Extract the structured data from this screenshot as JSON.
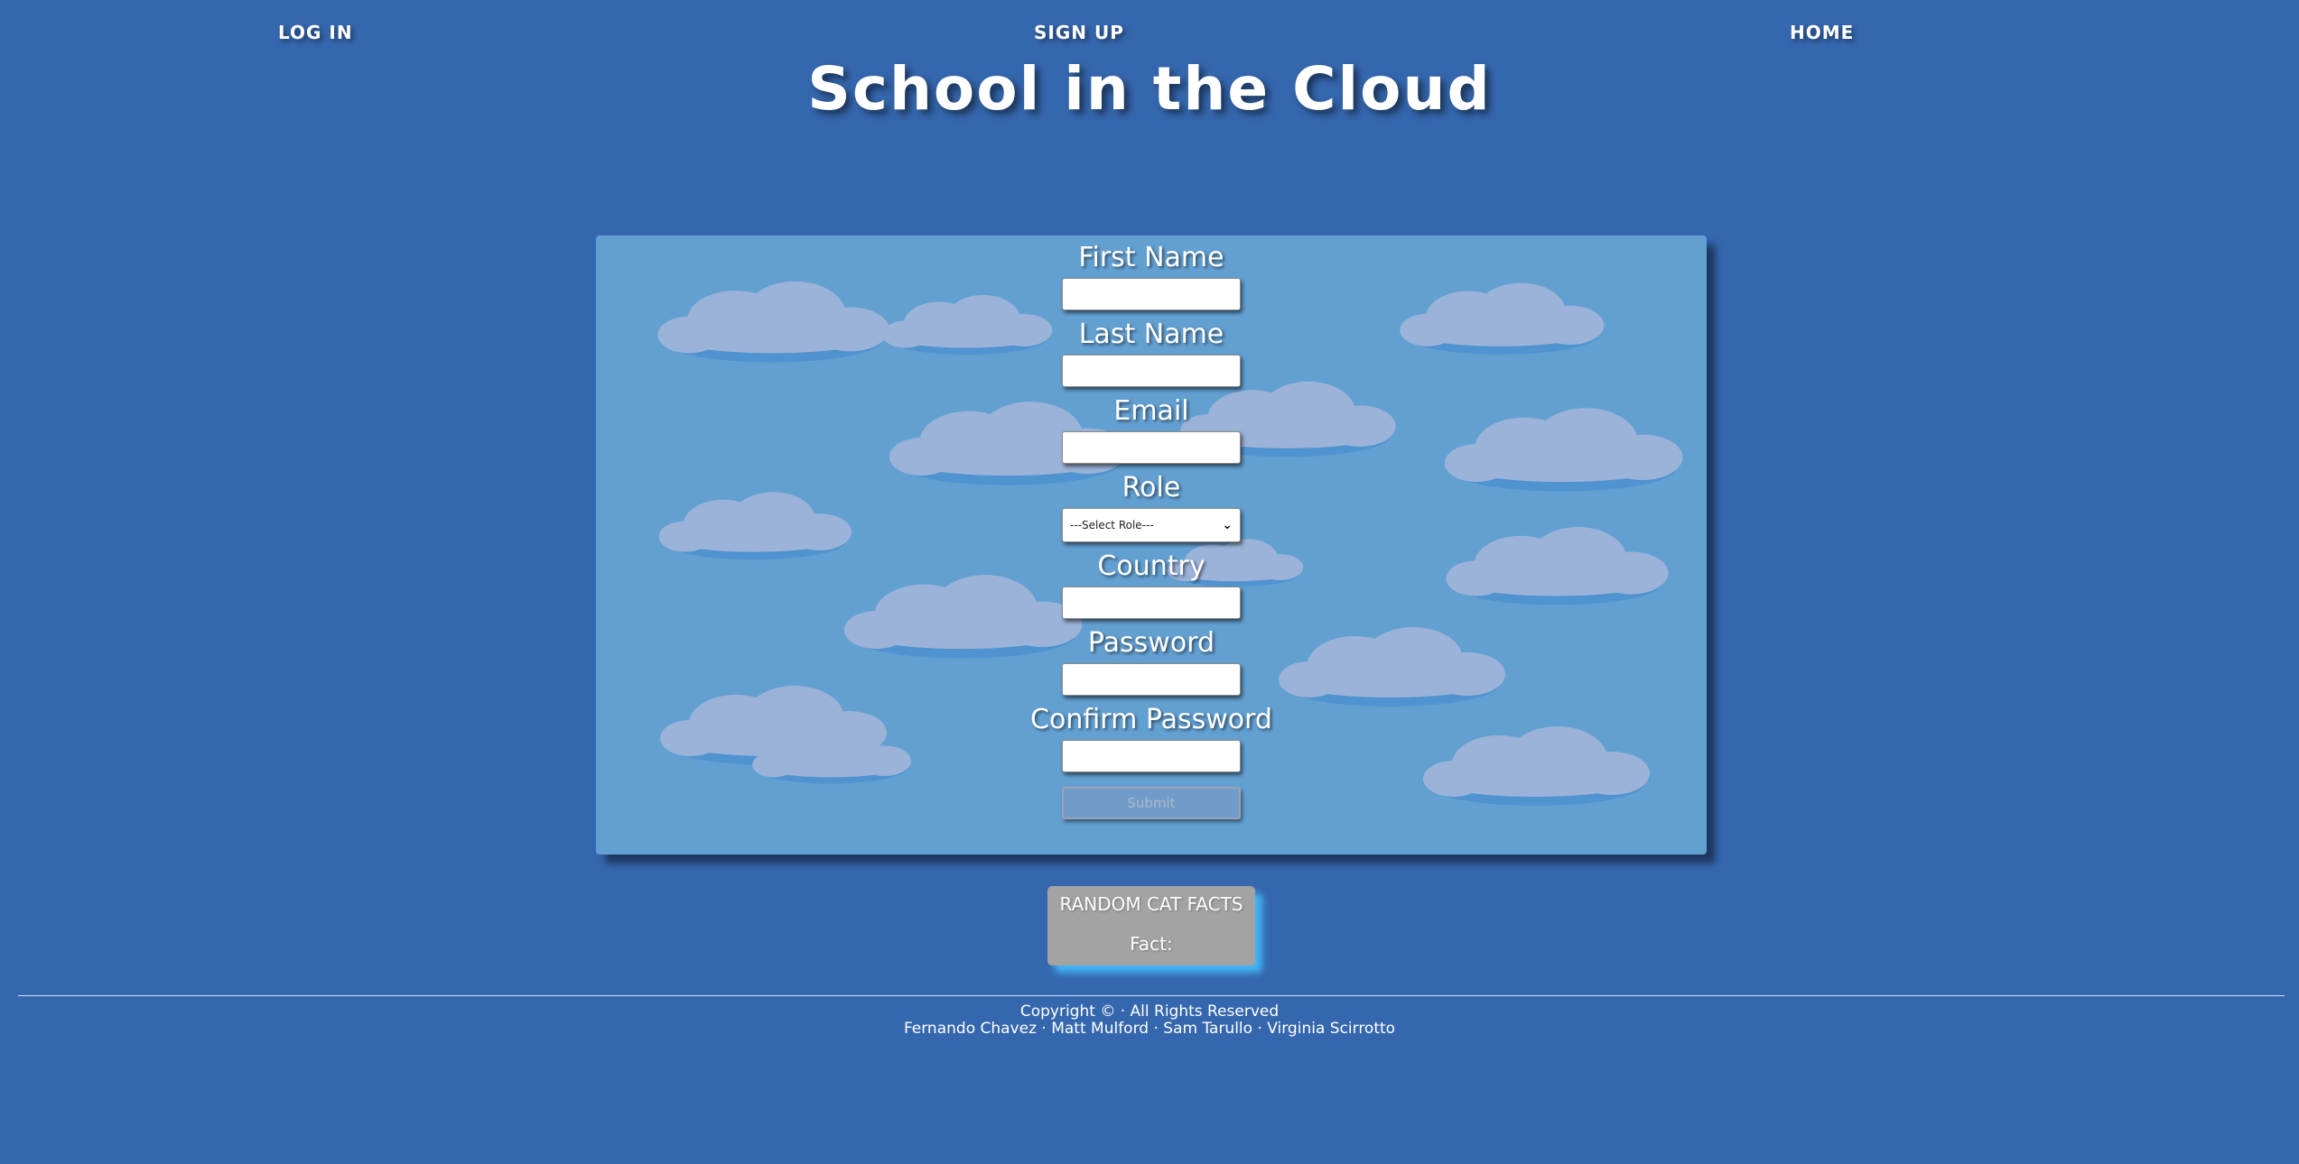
{
  "nav": {
    "login": "LOG IN",
    "signup": "SIGN UP",
    "home": "HOME"
  },
  "site_title": "School in the Cloud",
  "form": {
    "fields": [
      {
        "label": "First Name",
        "value": ""
      },
      {
        "label": "Last Name",
        "value": ""
      },
      {
        "label": "Email",
        "value": ""
      },
      {
        "label": "Role",
        "selected": "---Select Role---"
      },
      {
        "label": "Country",
        "value": ""
      },
      {
        "label": "Password",
        "value": ""
      },
      {
        "label": "Confirm Password",
        "value": ""
      }
    ],
    "submit_label": "Submit"
  },
  "cat_facts": {
    "title": "RANDOM CAT FACTS",
    "fact_label": "Fact:"
  },
  "footer": {
    "copyright": "Copyright © · All Rights Reserved",
    "credits": "Fernando Chavez · Matt Mulford · Sam Tarullo · Virginia Scirrotto"
  },
  "colors": {
    "page_background": "#3567ae",
    "panel_background": "#63a0d2",
    "cloud_fill": "#9cb3d9",
    "cloud_shadow": "#4f93d0",
    "cat_card": "#a3a3a3",
    "cat_card_glow": "#42b6f5"
  },
  "icons": {
    "select_chevron": "chevron-down-icon",
    "background_decoration": "cloud-icon"
  }
}
